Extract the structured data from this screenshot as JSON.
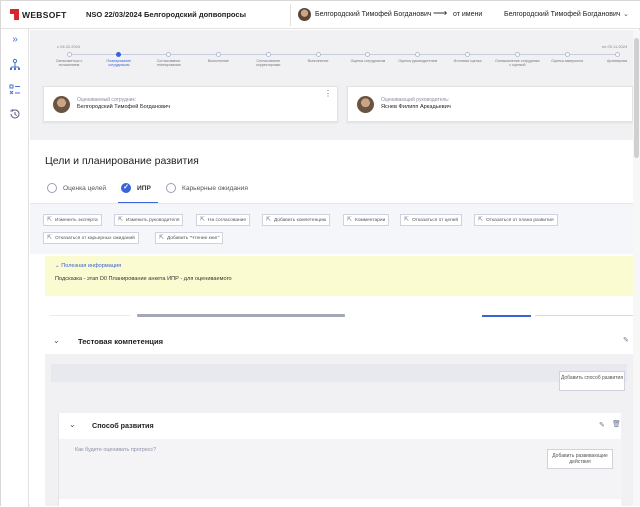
{
  "header": {
    "logo_text": "WEBSOFT",
    "context_title": "NSO 22/03/2024 Белгородский допвопросы",
    "current_user": "Белгородский Тимофей Богданович",
    "from_label": "от имени",
    "impersonated_user": "Белгородский Тимофей Богданович"
  },
  "stepper": {
    "date_start": "с 04.02.2024",
    "date_end": "по 09.11.2024",
    "active_index": 1,
    "steps": [
      "Ознакомиться с положением",
      "Планирование сотрудником",
      "Согласование планирования",
      "Выполнение",
      "Согласование корректировки",
      "Выполнение",
      "Оценка сотрудником",
      "Оценка руководителем",
      "Итоговая оценка",
      "Ознакомление сотрудника с оценкой",
      "Оценка завершена",
      "Архивирова"
    ]
  },
  "cards": {
    "employee_label": "Оцениваемый сотрудник:",
    "employee_name": "Белгородский Тимофей Богданович",
    "manager_label": "Оценивающий руководитель:",
    "manager_name": "Яснев Филипп Аркадьевич"
  },
  "main": {
    "title": "Цели и планирование развития",
    "tabs": [
      "Оценка целей",
      "ИПР",
      "Карьерные ожидания"
    ],
    "active_tab": 1,
    "actions": [
      "Изменить эксперта",
      "Изменить руководителя",
      "На согласование",
      "Добавить компетенцию",
      "Комментарии",
      "Отказаться от целей",
      "Отказаться от плана развития",
      "Отказаться от карьерных ожиданий",
      "Добавить \"Чтение книг\""
    ],
    "banner_title": "Полезная информация",
    "banner_text": "Подсказка - этап D0 Планирование анкета ИПР - для оцениваемого"
  },
  "competence": {
    "title": "Тестовая компетенция",
    "add_method_button": "Добавить способ развития",
    "method_title": "Способ развития",
    "progress_question": "Как будете оценивать прогресс?",
    "add_actions_button": "Добавить развивающие действия"
  },
  "colors": {
    "accent": "#3a63d8",
    "brand_red": "#d8252e",
    "banner_bg": "#fbfbd1"
  }
}
